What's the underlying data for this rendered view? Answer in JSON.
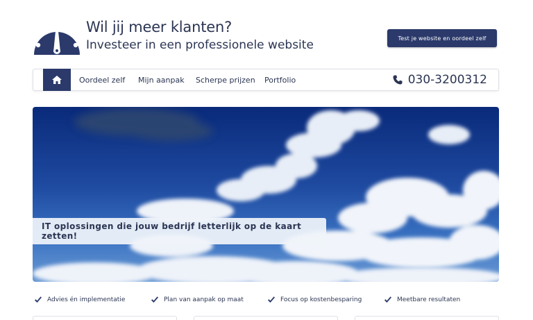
{
  "header": {
    "title": "Wil jij meer klanten?",
    "subtitle": "Investeer in een professionele website",
    "cta_label": "Test je website en oordeel zelf",
    "logo_icon": "speedometer-icon"
  },
  "nav": {
    "home_icon": "home-icon",
    "items": [
      {
        "label": "Oordeel zelf"
      },
      {
        "label": "Mijn aanpak"
      },
      {
        "label": "Scherpe prijzen"
      },
      {
        "label": "Portfolio"
      }
    ],
    "phone_icon": "phone-icon",
    "phone": "030-3200312"
  },
  "hero": {
    "caption": "IT oplossingen die jouw bedrijf letterlijk op de kaart zetten!"
  },
  "features": [
    {
      "label": "Advies én implementatie"
    },
    {
      "label": "Plan van aanpak op maat"
    },
    {
      "label": "Focus op kostenbesparing"
    },
    {
      "label": "Meetbare resultaten"
    }
  ],
  "colors": {
    "brand": "#2b3a6b",
    "text": "#2b3553",
    "border": "#dde0e6"
  }
}
